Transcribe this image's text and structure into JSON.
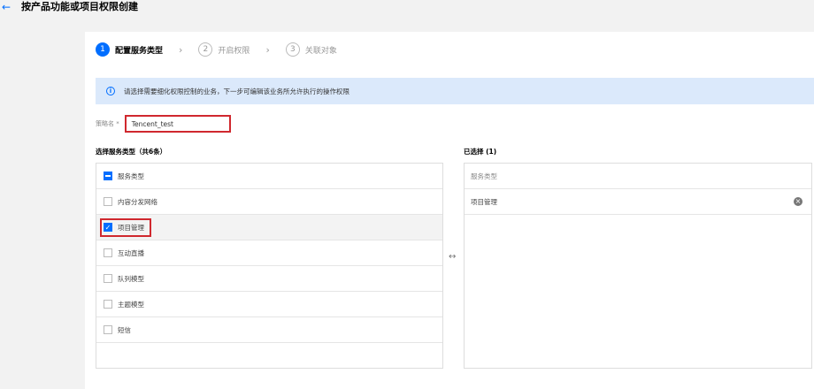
{
  "header": {
    "back_icon": "←",
    "title": "按产品功能或项目权限创建"
  },
  "steps": [
    {
      "num": "1",
      "label": "配置服务类型"
    },
    {
      "num": "2",
      "label": "开启权限"
    },
    {
      "num": "3",
      "label": "关联对象"
    }
  ],
  "step_separator": "›",
  "alert": {
    "icon": "i",
    "text": "请选择需要细化权限控制的业务，下一步可编辑该业务所允许执行的操作权限"
  },
  "policy": {
    "label": "策略名 *",
    "value": "Tencent_test"
  },
  "left_panel": {
    "title": "选择服务类型（共6条）",
    "header": "服务类型",
    "items": [
      {
        "label": "内容分发网络",
        "checked": false
      },
      {
        "label": "项目管理",
        "checked": true
      },
      {
        "label": "互动直播",
        "checked": false
      },
      {
        "label": "队列模型",
        "checked": false
      },
      {
        "label": "主题模型",
        "checked": false
      },
      {
        "label": "短信",
        "checked": false
      }
    ]
  },
  "right_panel": {
    "title": "已选择 (1)",
    "header": "服务类型",
    "items": [
      {
        "label": "项目管理"
      }
    ]
  },
  "transfer_icon": "↔",
  "colors": {
    "accent": "#006eff",
    "highlight": "#d0282e",
    "alert_bg": "#dbe9fb"
  }
}
